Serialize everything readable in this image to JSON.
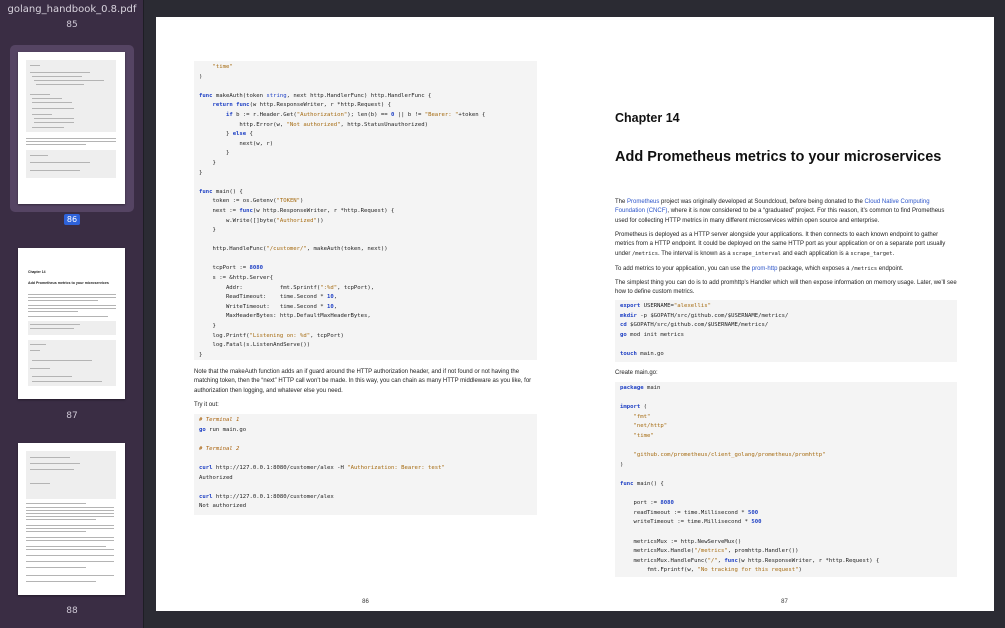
{
  "document": {
    "filename": "golang_handbook_0.8.pdf"
  },
  "sidebar": {
    "top_page_label": "85",
    "thumbnails": [
      {
        "label": "86",
        "selected": true
      },
      {
        "label": "87",
        "selected": false,
        "title": "Chapter 14",
        "subtitle": "Add Prometheus metrics to your microservices"
      },
      {
        "label": "88",
        "selected": false
      }
    ],
    "accent_color": "#2e62d9"
  },
  "left_page": {
    "number": "86",
    "intro_code": [
      "    \"time\"",
      ")",
      "",
      "func makeAuth(token string, next http.HandlerFunc) http.HandlerFunc {",
      "    return func(w http.ResponseWriter, r *http.Request) {",
      "        if b := r.Header.Get(\"Authorization\"); len(b) == 0 || b != \"Bearer: \"+token {",
      "            http.Error(w, \"Not authorized\", http.StatusUnauthorized)",
      "        } else {",
      "            next(w, r)",
      "        }",
      "    }",
      "}",
      "",
      "func main() {",
      "    token := os.Getenv(\"TOKEN\")",
      "    next := func(w http.ResponseWriter, r *http.Request) {",
      "        w.Write([]byte(\"Authorized\"))",
      "    }",
      "",
      "    http.HandleFunc(\"/customer/\", makeAuth(token, next))",
      "",
      "    tcpPort := 8080",
      "    s := &http.Server{",
      "        Addr:           fmt.Sprintf(\":%d\", tcpPort),",
      "        ReadTimeout:    time.Second * 10,",
      "        WriteTimeout:   time.Second * 10,",
      "        MaxHeaderBytes: http.DefaultMaxHeaderBytes,",
      "    }",
      "    log.Printf(\"Listening on: %d\", tcpPort)",
      "    log.Fatal(s.ListenAndServe())",
      "}"
    ],
    "note_paragraph": "Note that the makeAuth function adds an if guard around the HTTP authorization header, and if not found or not having the matching token, then the “next” HTTP call won’t be made. In this way, you can chain as many HTTP middleware as you like, for authorization then logging, and whatever else you need.",
    "try_label": "Try it out:",
    "terminal_code": [
      "# Terminal 1",
      "go run main.go",
      "",
      "# Terminal 2",
      "",
      "curl http://127.0.0.1:8080/customer/alex -H \"Authorization: Bearer: test\"",
      "Authorized",
      "",
      "curl http://127.0.0.1:8080/customer/alex",
      "Not authorized"
    ]
  },
  "right_page": {
    "number": "87",
    "chapter_label": "Chapter 14",
    "chapter_title": "Add Prometheus metrics to your microservices",
    "p1": {
      "a": "The ",
      "link1": "Prometheus",
      "b": " project was originally developed at Soundcloud, before being donated to the ",
      "link2": "Cloud Native Computing Foundation (CNCF)",
      "c": ", where it is now considered to be a “graduated” project. For this reason, it’s common to find Prometheus used for collecting HTTP metrics in many different microservices within open source and enterprise."
    },
    "p2": {
      "a": "Prometheus is deployed as a HTTP server alongside your applications. It then connects to each known endpoint to gather metrics from a HTTP endpoint. It could be deployed on the same HTTP port as your application or on a separate port usually under ",
      "code1": "/metrics",
      "b": ". The interval is known as a ",
      "code2": "scrape_interval",
      "c": " and each application is a ",
      "code3": "scrape_target",
      "d": "."
    },
    "p3": {
      "a": "To add metrics to your application, you can use the ",
      "link": "prom-http",
      "b": " package, which exposes a ",
      "code": "/metrics",
      "c": " endpoint."
    },
    "p4": "The simplest thing you can do is to add promhttp’s Handler which will then expose information on memory usage. Later, we’ll see how to define custom metrics.",
    "shell_code": [
      "export USERNAME=\"alexellis\"",
      "mkdir -p $GOPATH/src/github.com/$USERNAME/metrics/",
      "cd $GOPATH/src/github.com/$USERNAME/metrics/",
      "go mod init metrics",
      "",
      "touch main.go"
    ],
    "create_label": "Create main.go:",
    "main_code": [
      "package main",
      "",
      "import (",
      "    \"fmt\"",
      "    \"net/http\"",
      "    \"time\"",
      "",
      "    \"github.com/prometheus/client_golang/prometheus/promhttp\"",
      ")",
      "",
      "func main() {",
      "",
      "    port := 8080",
      "    readTimeout := time.Millisecond * 500",
      "    writeTimeout := time.Millisecond * 500",
      "",
      "    metricsMux := http.NewServeMux()",
      "    metricsMux.Handle(\"/metrics\", promhttp.Handler())",
      "    metricsMux.HandleFunc(\"/\", func(w http.ResponseWriter, r *http.Request) {",
      "        fmt.Fprintf(w, \"No tracking for this request\")"
    ]
  }
}
